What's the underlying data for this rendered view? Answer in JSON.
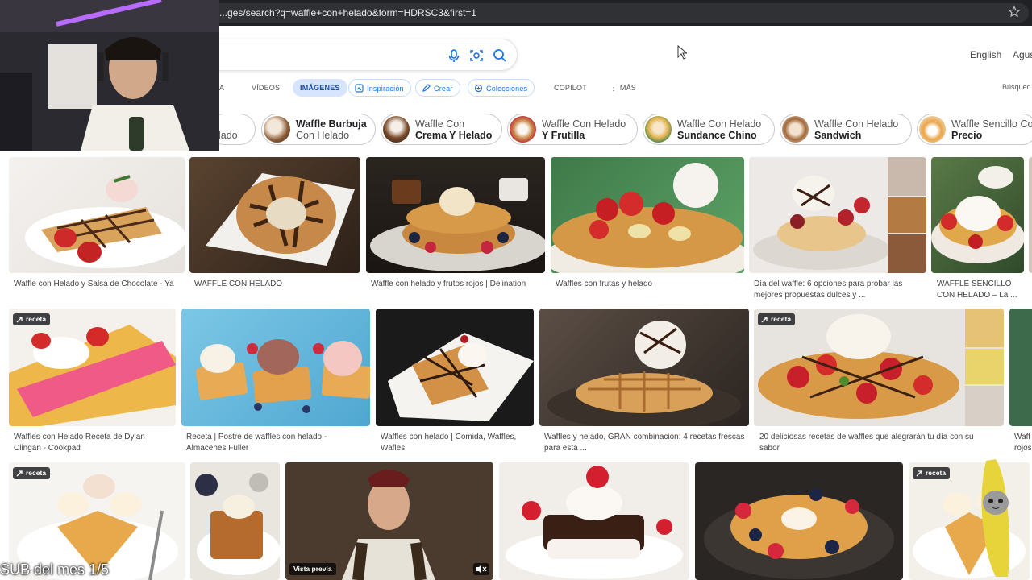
{
  "browser": {
    "url": "...ges/search?q=waffle+con+helado&form=HDRSC3&first=1"
  },
  "header": {
    "language": "English",
    "user_partial": "Agus"
  },
  "tabs": [
    {
      "label": "A"
    },
    {
      "label": "VÍDEOS"
    },
    {
      "label": "IMÁGENES"
    },
    {
      "label": "Inspiración"
    },
    {
      "label": "Crear"
    },
    {
      "label": "Colecciones"
    },
    {
      "label": "COPILOT"
    },
    {
      "label": "MÁS"
    }
  ],
  "tabs_right": "Búsqued",
  "chips": [
    {
      "regular": "lado",
      "bold": ""
    },
    {
      "bold": "Waffle Burbuja",
      "regular": "Con Helado"
    },
    {
      "regular": "Waffle Con",
      "bold": "Crema Y Helado"
    },
    {
      "regular": "Waffle Con Helado",
      "bold": "Y Frutilla"
    },
    {
      "regular": "Waffle Con Helado",
      "bold": "Sundance Chino"
    },
    {
      "regular": "Waffle Con Helado",
      "bold": "Sandwich"
    },
    {
      "regular": "Waffle Sencillo Co",
      "bold": "Precio"
    }
  ],
  "row1_captions": [
    "Waffle con Helado y Salsa de Chocolate - Ya",
    "WAFFLE CON HELADO",
    "Waffle con helado y frutos rojos | Delination",
    "Waffles con frutas y helado",
    "Día del waffle: 6 opciones para probar las mejores propuestas dulces y ...",
    "WAFFLE SENCILLO CON HELADO – La ..."
  ],
  "row2_captions": [
    "Waffles con Helado Receta de Dylan Clingan - Cookpad",
    "Receta | Postre de waffles con helado - Almacenes Fuller",
    "Waffles con helado | Comida, Waffles, Wafles",
    "Waffles y helado, GRAN combinación: 4 recetas frescas para esta ...",
    "20 deliciosas recetas de waffles que alegrarán tu día con su sabor",
    "Waff rojos"
  ],
  "badge_label": "receta",
  "video_preview_label": "Vista previa",
  "stream_overlay": "SUB del mes 1/5",
  "icons": [
    "star-icon",
    "mic-icon",
    "visual-search-icon",
    "search-icon",
    "inspiration-icon",
    "create-icon",
    "collections-icon",
    "more-dots-icon",
    "recipe-icon",
    "mute-icon"
  ],
  "colors": {
    "accent": "#174ea6",
    "active_tab_bg": "#d6e4ff",
    "addr_bg": "#202124"
  }
}
